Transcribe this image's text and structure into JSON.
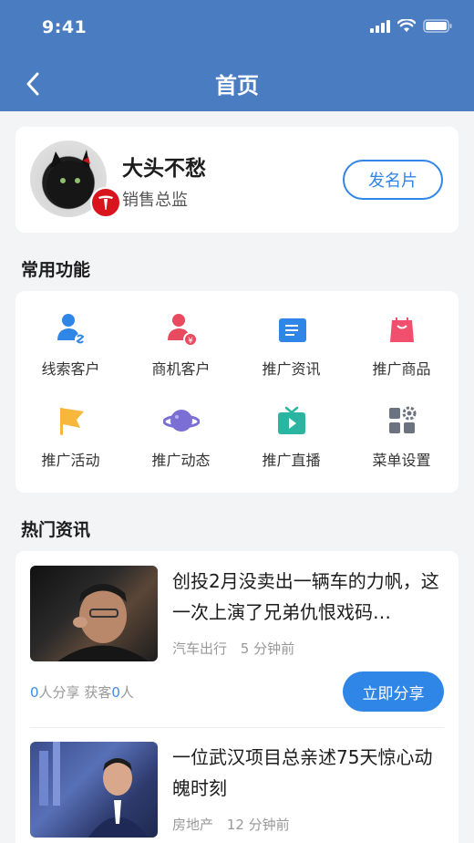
{
  "status": {
    "time": "9:41"
  },
  "nav": {
    "title": "首页"
  },
  "profile": {
    "name": "大头不愁",
    "title": "销售总监",
    "card_button": "发名片"
  },
  "functions": {
    "title": "常用功能",
    "items": [
      {
        "label": "线索客户",
        "icon": "lead-customer-icon",
        "color": "#2f86e6"
      },
      {
        "label": "商机客户",
        "icon": "opportunity-customer-icon",
        "color": "#e84a5f"
      },
      {
        "label": "推广资讯",
        "icon": "promo-news-icon",
        "color": "#2f86e6"
      },
      {
        "label": "推广商品",
        "icon": "promo-goods-icon",
        "color": "#f0506e"
      },
      {
        "label": "推广活动",
        "icon": "flag-icon",
        "color": "#f6b73c"
      },
      {
        "label": "推广动态",
        "icon": "planet-icon",
        "color": "#7b6fd6"
      },
      {
        "label": "推广直播",
        "icon": "tv-live-icon",
        "color": "#2bb5a0"
      },
      {
        "label": "菜单设置",
        "icon": "menu-settings-icon",
        "color": "#6b7280"
      }
    ]
  },
  "hot_news": {
    "title": "热门资讯",
    "items": [
      {
        "title": "创投2月没卖出一辆车的力帆，这一次上演了兄弟仇恨戏码…",
        "category": "汽车出行",
        "time": "5 分钟前",
        "share_count": "0",
        "share_text": "人分享",
        "gain_prefix": "获客",
        "gain_count": "0",
        "gain_suffix": "人",
        "share_button": "立即分享"
      },
      {
        "title": "一位武汉项目总亲述75天惊心动魄时刻",
        "category": "房地产",
        "time": "12 分钟前"
      }
    ]
  },
  "colors": {
    "primary": "#2f86e6",
    "header": "#4a7cc1"
  }
}
